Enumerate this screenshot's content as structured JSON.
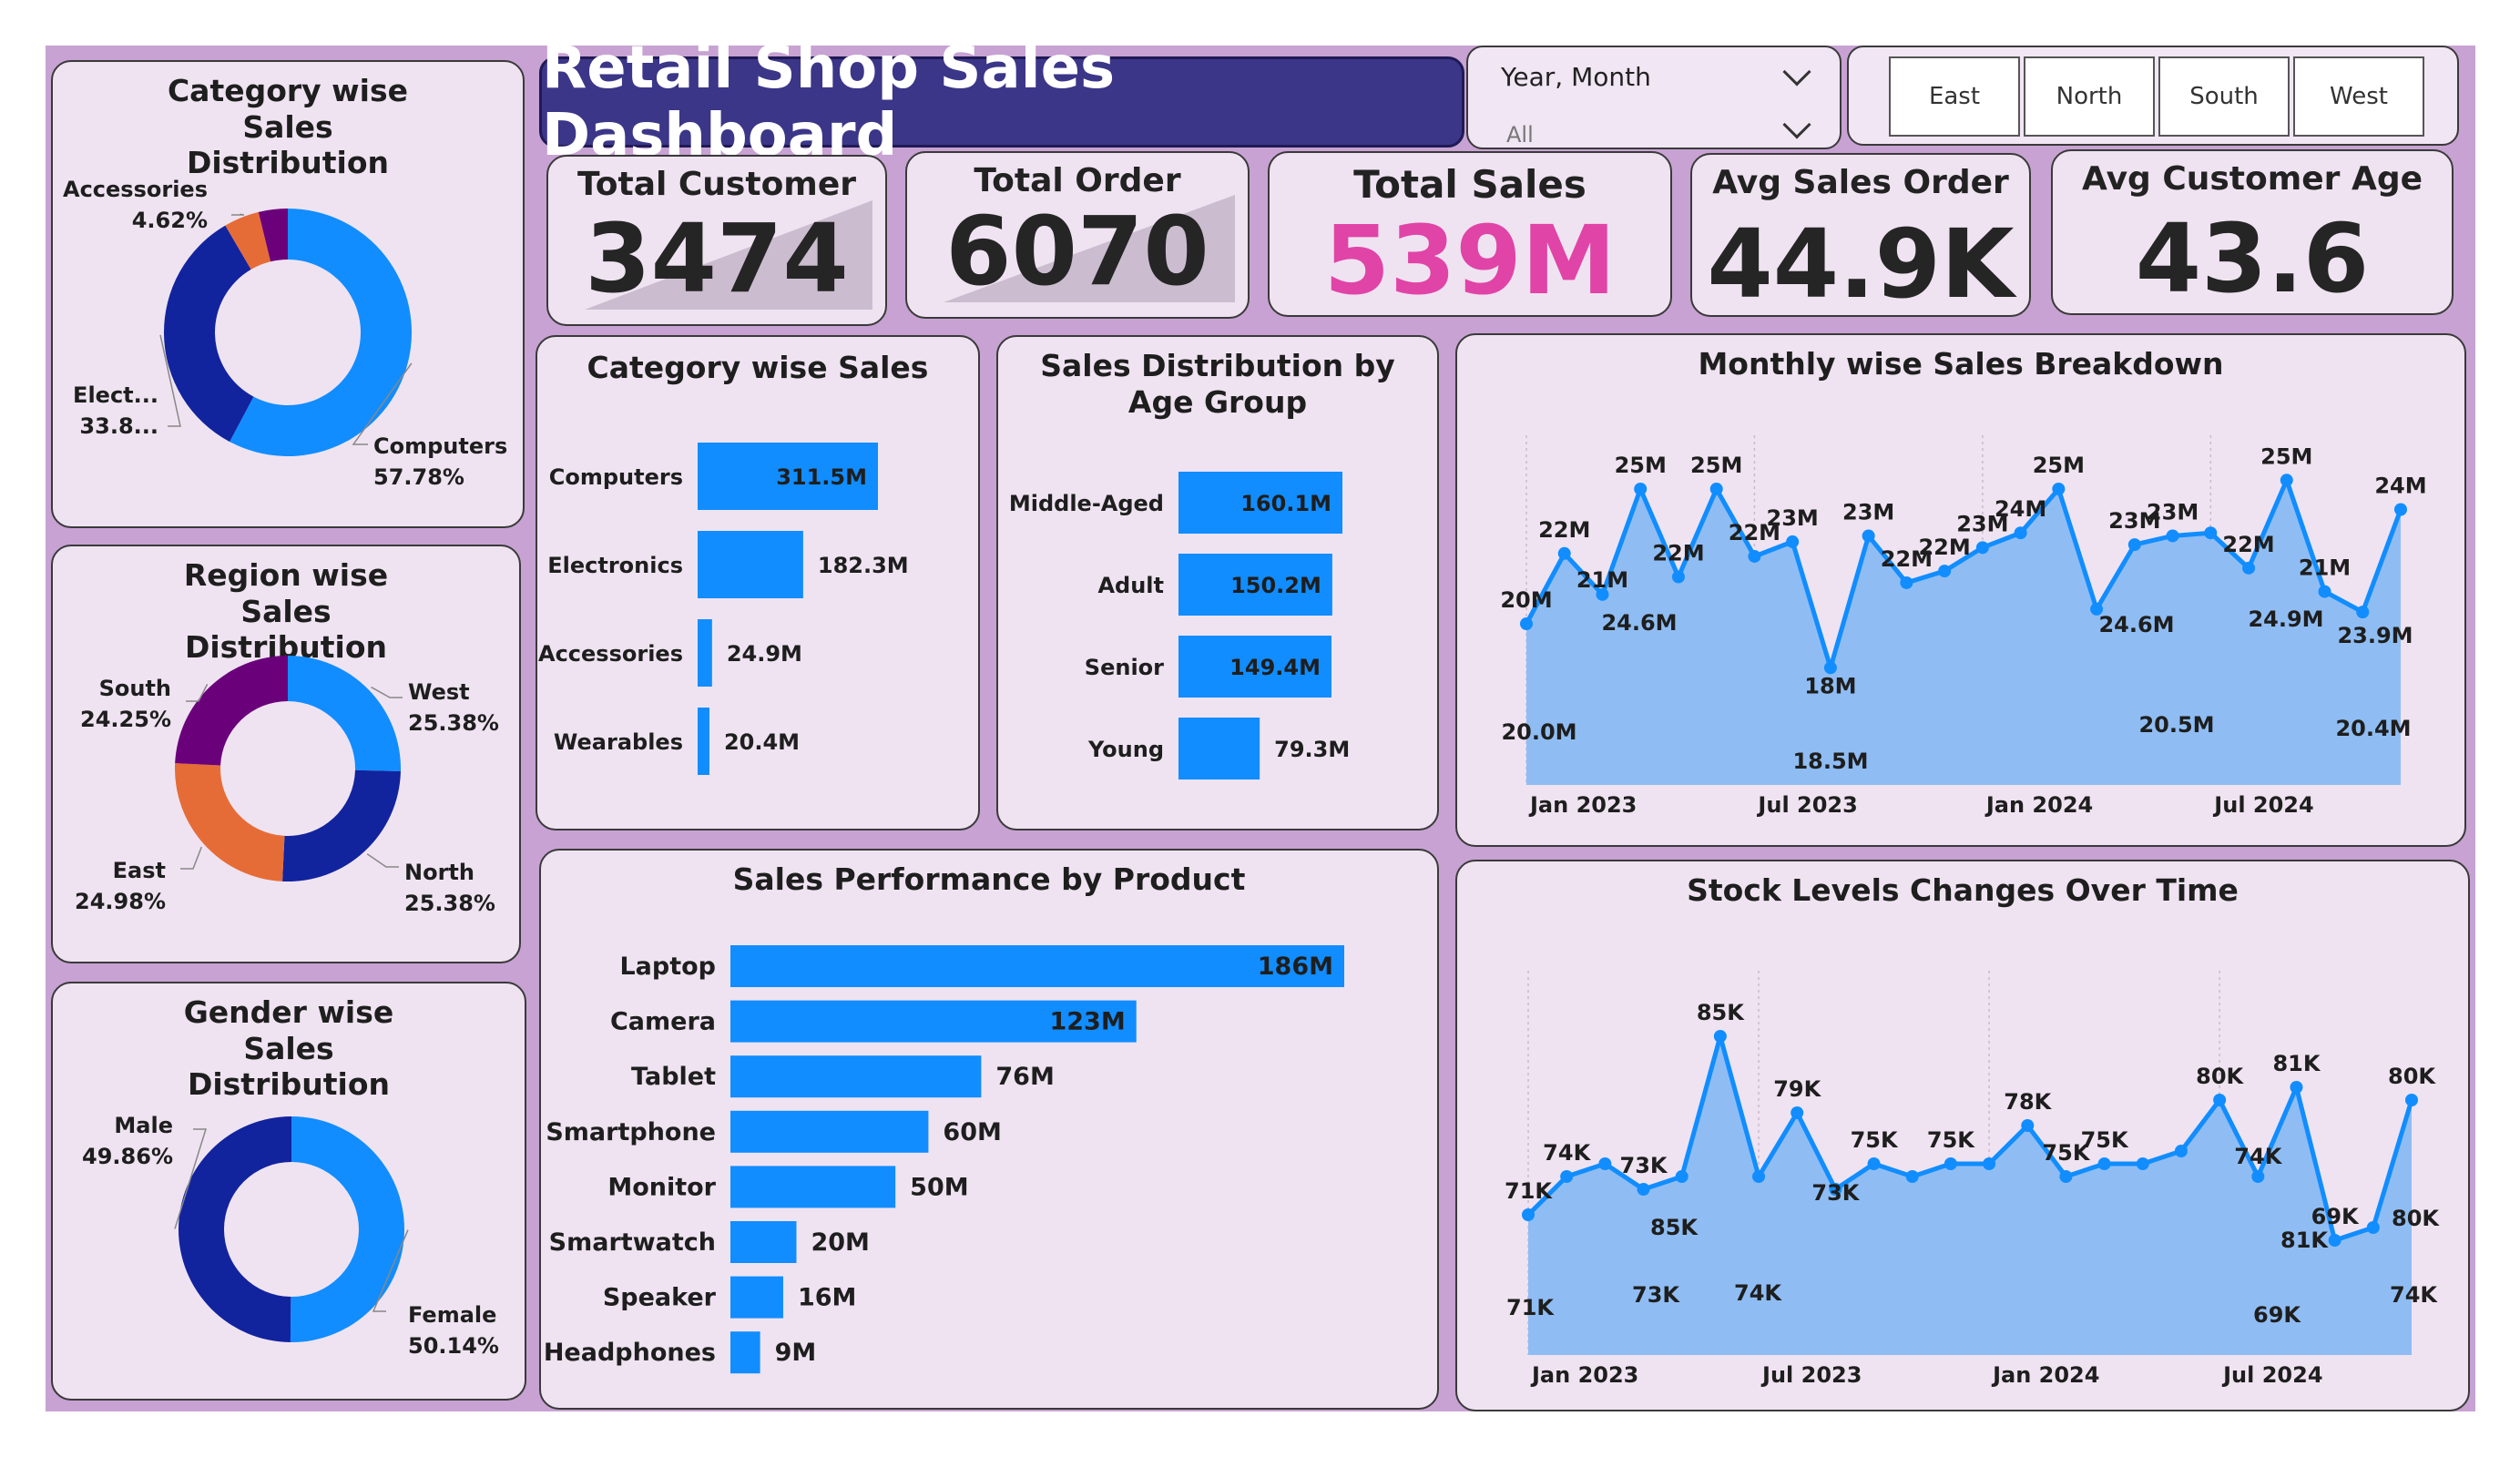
{
  "title": "Retail Shop Sales Dashboard",
  "slicers": {
    "date_label": "Year, Month",
    "date_value": "All",
    "regions": [
      "East",
      "North",
      "South",
      "West"
    ]
  },
  "kpis": [
    {
      "label": "Total Customer",
      "value": "3474"
    },
    {
      "label": "Total Order",
      "value": "6070"
    },
    {
      "label": "Total Sales",
      "value": "539M"
    },
    {
      "label": "Avg Sales Order",
      "value": "44.9K"
    },
    {
      "label": "Avg Customer Age",
      "value": "43.6"
    }
  ],
  "colors": {
    "blue": "#118dff",
    "navy": "#12239e",
    "orange": "#e66c37",
    "purple": "#6b007b",
    "pink": "#e044a7",
    "area": "#8fbdf3",
    "background": "#c7a2d3",
    "card": "#efe3f1",
    "title_bar": "#3b3688"
  },
  "chart_data": [
    {
      "id": "category_donut",
      "type": "pie",
      "title": "Category wise Sales Distribution",
      "slices": [
        {
          "name": "Computers",
          "value": 57.78,
          "label": "57.78%"
        },
        {
          "name": "Elect...",
          "value": 33.8,
          "label": "33.8..."
        },
        {
          "name": "Accessories",
          "value": 4.62,
          "label": "4.62%"
        },
        {
          "name": "Wearables",
          "value": 3.8,
          "label": ""
        }
      ]
    },
    {
      "id": "region_donut",
      "type": "pie",
      "title": "Region wise Sales Distribution",
      "slices": [
        {
          "name": "West",
          "value": 25.38,
          "label": "25.38%"
        },
        {
          "name": "North",
          "value": 25.38,
          "label": "25.38%"
        },
        {
          "name": "East",
          "value": 24.98,
          "label": "24.98%"
        },
        {
          "name": "South",
          "value": 24.25,
          "label": "24.25%"
        }
      ]
    },
    {
      "id": "gender_donut",
      "type": "pie",
      "title": "Gender wise Sales Distribution",
      "slices": [
        {
          "name": "Female",
          "value": 50.14,
          "label": "50.14%"
        },
        {
          "name": "Male",
          "value": 49.86,
          "label": "49.86%"
        }
      ]
    },
    {
      "id": "category_bar",
      "type": "bar",
      "title": "Category wise Sales",
      "categories": [
        "Computers",
        "Electronics",
        "Accessories",
        "Wearables"
      ],
      "values": [
        311.5,
        182.3,
        24.9,
        20.4
      ],
      "labels": [
        "311.5M",
        "182.3M",
        "24.9M",
        "20.4M"
      ]
    },
    {
      "id": "age_bar",
      "type": "bar",
      "title": "Sales Distribution by Age Group",
      "categories": [
        "Middle-Aged",
        "Adult",
        "Senior",
        "Young"
      ],
      "values": [
        160.1,
        150.2,
        149.4,
        79.3
      ],
      "labels": [
        "160.1M",
        "150.2M",
        "149.4M",
        "79.3M"
      ]
    },
    {
      "id": "product_bar",
      "type": "bar",
      "title": "Sales Performance by Product",
      "categories": [
        "Laptop",
        "Camera",
        "Tablet",
        "Smartphone",
        "Monitor",
        "Smartwatch",
        "Speaker",
        "Headphones"
      ],
      "values": [
        186,
        123,
        76,
        60,
        50,
        20,
        16,
        9
      ],
      "labels": [
        "186M",
        "123M",
        "76M",
        "60M",
        "50M",
        "20M",
        "16M",
        "9M"
      ]
    },
    {
      "id": "monthly_sales",
      "type": "area",
      "title": "Monthly wise Sales Breakdown",
      "x_ticks": [
        "Jan 2023",
        "Jul 2023",
        "Jan 2024",
        "Jul 2024"
      ],
      "values": [
        20.0,
        22.4,
        21.0,
        24.6,
        21.6,
        24.6,
        22.3,
        22.8,
        18.5,
        23.0,
        21.4,
        21.8,
        22.6,
        23.1,
        24.6,
        20.5,
        22.7,
        23.0,
        23.1,
        21.9,
        24.9,
        21.1,
        20.4,
        23.9
      ],
      "labels": [
        "20M",
        "22M",
        "21M",
        "25M",
        "22M",
        "25M",
        "22M",
        "23M",
        "18M",
        "23M",
        "22M",
        "22M",
        "23M",
        "24M",
        "25M",
        "",
        "23M",
        "23M",
        "",
        "22M",
        "25M",
        "21M",
        "",
        "24M"
      ],
      "extra_labels": [
        "20.0M",
        "24.6M",
        "18.5M",
        "24.6M",
        "20.5M",
        "24.9M",
        "20.4M",
        "23.9M"
      ]
    },
    {
      "id": "stock_levels",
      "type": "area",
      "title": "Stock Levels Changes Over Time",
      "x_ticks": [
        "Jan 2023",
        "Jul 2023",
        "Jan 2024",
        "Jul 2024"
      ],
      "values": [
        71,
        74,
        75,
        73,
        74,
        85,
        74,
        79,
        73,
        75,
        74,
        75,
        75,
        78,
        74,
        75,
        75,
        76,
        80,
        74,
        81,
        69,
        70,
        80
      ],
      "labels": [
        "71K",
        "74K",
        "",
        "73K",
        "",
        "85K",
        "",
        "79K",
        "73K",
        "75K",
        "",
        "75K",
        "",
        "78K",
        "75K",
        "75K",
        "",
        "",
        "80K",
        "74K",
        "81K",
        "69K",
        "",
        "80K"
      ],
      "extra_labels": [
        "71K",
        "73K",
        "85K",
        "74K",
        "74K",
        "81K",
        "69K",
        "80K"
      ]
    }
  ]
}
